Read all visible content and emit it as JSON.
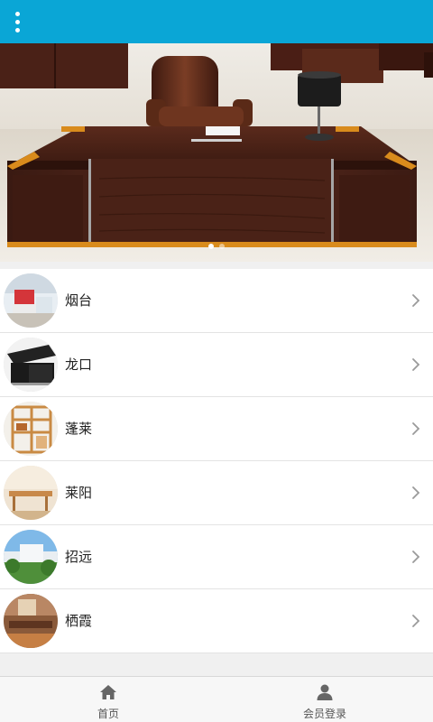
{
  "header": {
    "menu_icon": "more-vertical-icon",
    "bg_color": "#0aa6d6"
  },
  "banner": {
    "slides": 2,
    "active_slide": 1
  },
  "list": {
    "items": [
      {
        "label": "烟台"
      },
      {
        "label": "龙口"
      },
      {
        "label": "蓬莱"
      },
      {
        "label": "莱阳"
      },
      {
        "label": "招远"
      },
      {
        "label": "栖霞"
      }
    ]
  },
  "bottom_nav": {
    "items": [
      {
        "label": "首页",
        "icon": "home-icon"
      },
      {
        "label": "会员登录",
        "icon": "user-icon"
      }
    ]
  }
}
